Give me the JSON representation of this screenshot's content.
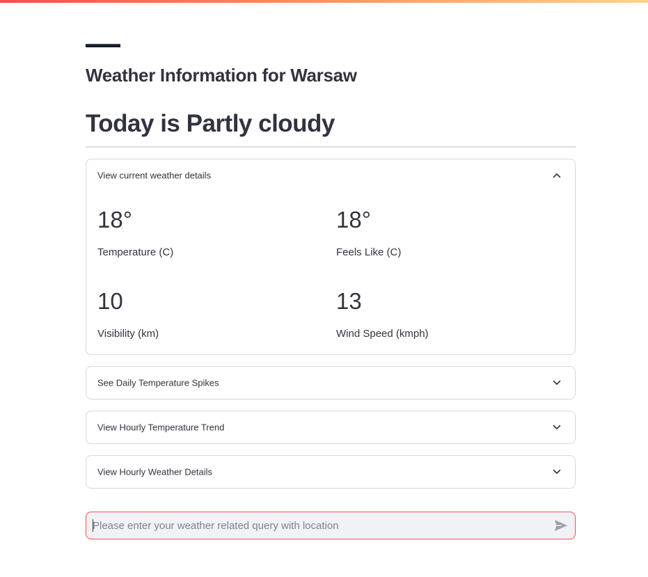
{
  "header": {
    "subtitle": "Weather Information for Warsaw",
    "title": "Today is Partly cloudy",
    "accent_gradient": [
      "#ff4b4b",
      "#ffd28a"
    ]
  },
  "expanders": [
    {
      "label": "View current weather details",
      "expanded": true,
      "icon": "chevron-up-icon",
      "metrics": [
        {
          "value": "18°",
          "label": "Temperature (C)"
        },
        {
          "value": "18°",
          "label": "Feels Like (C)"
        },
        {
          "value": "10",
          "label": "Visibility (km)"
        },
        {
          "value": "13",
          "label": "Wind Speed (kmph)"
        }
      ]
    },
    {
      "label": "See Daily Temperature Spikes",
      "expanded": false,
      "icon": "chevron-down-icon"
    },
    {
      "label": "View Hourly Temperature Trend",
      "expanded": false,
      "icon": "chevron-down-icon"
    },
    {
      "label": "View Hourly Weather Details",
      "expanded": false,
      "icon": "chevron-down-icon"
    }
  ],
  "chat": {
    "placeholder": "Please enter your weather related query with location",
    "value": "",
    "focus_border_color": "#ff4b4b",
    "send_icon": "send-icon"
  }
}
